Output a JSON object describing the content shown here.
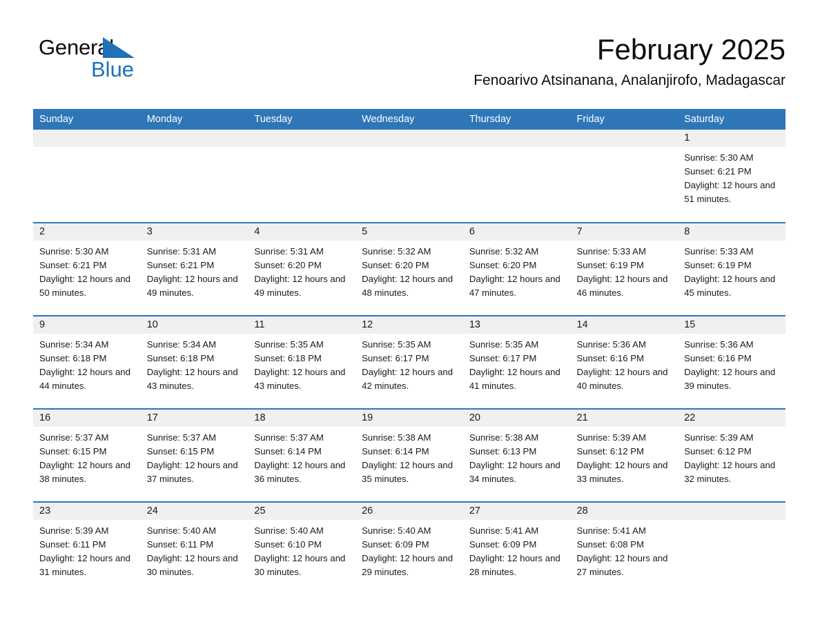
{
  "brand": {
    "name_part1": "General",
    "name_part2": "Blue",
    "triangle_color": "#1f71b8"
  },
  "header": {
    "month_title": "February 2025",
    "location": "Fenoarivo Atsinanana, Analanjirofo, Madagascar"
  },
  "theme": {
    "header_blue": "#2e76b8",
    "daynum_bg": "#f0f0f0",
    "text": "#1a1a1a"
  },
  "weekday_headers": [
    "Sunday",
    "Monday",
    "Tuesday",
    "Wednesday",
    "Thursday",
    "Friday",
    "Saturday"
  ],
  "weeks": [
    [
      {
        "day": "",
        "blank": true
      },
      {
        "day": "",
        "blank": true
      },
      {
        "day": "",
        "blank": true
      },
      {
        "day": "",
        "blank": true
      },
      {
        "day": "",
        "blank": true
      },
      {
        "day": "",
        "blank": true
      },
      {
        "day": "1",
        "sunrise": "Sunrise: 5:30 AM",
        "sunset": "Sunset: 6:21 PM",
        "daylight": "Daylight: 12 hours and 51 minutes."
      }
    ],
    [
      {
        "day": "2",
        "sunrise": "Sunrise: 5:30 AM",
        "sunset": "Sunset: 6:21 PM",
        "daylight": "Daylight: 12 hours and 50 minutes."
      },
      {
        "day": "3",
        "sunrise": "Sunrise: 5:31 AM",
        "sunset": "Sunset: 6:21 PM",
        "daylight": "Daylight: 12 hours and 49 minutes."
      },
      {
        "day": "4",
        "sunrise": "Sunrise: 5:31 AM",
        "sunset": "Sunset: 6:20 PM",
        "daylight": "Daylight: 12 hours and 49 minutes."
      },
      {
        "day": "5",
        "sunrise": "Sunrise: 5:32 AM",
        "sunset": "Sunset: 6:20 PM",
        "daylight": "Daylight: 12 hours and 48 minutes."
      },
      {
        "day": "6",
        "sunrise": "Sunrise: 5:32 AM",
        "sunset": "Sunset: 6:20 PM",
        "daylight": "Daylight: 12 hours and 47 minutes."
      },
      {
        "day": "7",
        "sunrise": "Sunrise: 5:33 AM",
        "sunset": "Sunset: 6:19 PM",
        "daylight": "Daylight: 12 hours and 46 minutes."
      },
      {
        "day": "8",
        "sunrise": "Sunrise: 5:33 AM",
        "sunset": "Sunset: 6:19 PM",
        "daylight": "Daylight: 12 hours and 45 minutes."
      }
    ],
    [
      {
        "day": "9",
        "sunrise": "Sunrise: 5:34 AM",
        "sunset": "Sunset: 6:18 PM",
        "daylight": "Daylight: 12 hours and 44 minutes."
      },
      {
        "day": "10",
        "sunrise": "Sunrise: 5:34 AM",
        "sunset": "Sunset: 6:18 PM",
        "daylight": "Daylight: 12 hours and 43 minutes."
      },
      {
        "day": "11",
        "sunrise": "Sunrise: 5:35 AM",
        "sunset": "Sunset: 6:18 PM",
        "daylight": "Daylight: 12 hours and 43 minutes."
      },
      {
        "day": "12",
        "sunrise": "Sunrise: 5:35 AM",
        "sunset": "Sunset: 6:17 PM",
        "daylight": "Daylight: 12 hours and 42 minutes."
      },
      {
        "day": "13",
        "sunrise": "Sunrise: 5:35 AM",
        "sunset": "Sunset: 6:17 PM",
        "daylight": "Daylight: 12 hours and 41 minutes."
      },
      {
        "day": "14",
        "sunrise": "Sunrise: 5:36 AM",
        "sunset": "Sunset: 6:16 PM",
        "daylight": "Daylight: 12 hours and 40 minutes."
      },
      {
        "day": "15",
        "sunrise": "Sunrise: 5:36 AM",
        "sunset": "Sunset: 6:16 PM",
        "daylight": "Daylight: 12 hours and 39 minutes."
      }
    ],
    [
      {
        "day": "16",
        "sunrise": "Sunrise: 5:37 AM",
        "sunset": "Sunset: 6:15 PM",
        "daylight": "Daylight: 12 hours and 38 minutes."
      },
      {
        "day": "17",
        "sunrise": "Sunrise: 5:37 AM",
        "sunset": "Sunset: 6:15 PM",
        "daylight": "Daylight: 12 hours and 37 minutes."
      },
      {
        "day": "18",
        "sunrise": "Sunrise: 5:37 AM",
        "sunset": "Sunset: 6:14 PM",
        "daylight": "Daylight: 12 hours and 36 minutes."
      },
      {
        "day": "19",
        "sunrise": "Sunrise: 5:38 AM",
        "sunset": "Sunset: 6:14 PM",
        "daylight": "Daylight: 12 hours and 35 minutes."
      },
      {
        "day": "20",
        "sunrise": "Sunrise: 5:38 AM",
        "sunset": "Sunset: 6:13 PM",
        "daylight": "Daylight: 12 hours and 34 minutes."
      },
      {
        "day": "21",
        "sunrise": "Sunrise: 5:39 AM",
        "sunset": "Sunset: 6:12 PM",
        "daylight": "Daylight: 12 hours and 33 minutes."
      },
      {
        "day": "22",
        "sunrise": "Sunrise: 5:39 AM",
        "sunset": "Sunset: 6:12 PM",
        "daylight": "Daylight: 12 hours and 32 minutes."
      }
    ],
    [
      {
        "day": "23",
        "sunrise": "Sunrise: 5:39 AM",
        "sunset": "Sunset: 6:11 PM",
        "daylight": "Daylight: 12 hours and 31 minutes."
      },
      {
        "day": "24",
        "sunrise": "Sunrise: 5:40 AM",
        "sunset": "Sunset: 6:11 PM",
        "daylight": "Daylight: 12 hours and 30 minutes."
      },
      {
        "day": "25",
        "sunrise": "Sunrise: 5:40 AM",
        "sunset": "Sunset: 6:10 PM",
        "daylight": "Daylight: 12 hours and 30 minutes."
      },
      {
        "day": "26",
        "sunrise": "Sunrise: 5:40 AM",
        "sunset": "Sunset: 6:09 PM",
        "daylight": "Daylight: 12 hours and 29 minutes."
      },
      {
        "day": "27",
        "sunrise": "Sunrise: 5:41 AM",
        "sunset": "Sunset: 6:09 PM",
        "daylight": "Daylight: 12 hours and 28 minutes."
      },
      {
        "day": "28",
        "sunrise": "Sunrise: 5:41 AM",
        "sunset": "Sunset: 6:08 PM",
        "daylight": "Daylight: 12 hours and 27 minutes."
      },
      {
        "day": "",
        "blank": true
      }
    ]
  ]
}
